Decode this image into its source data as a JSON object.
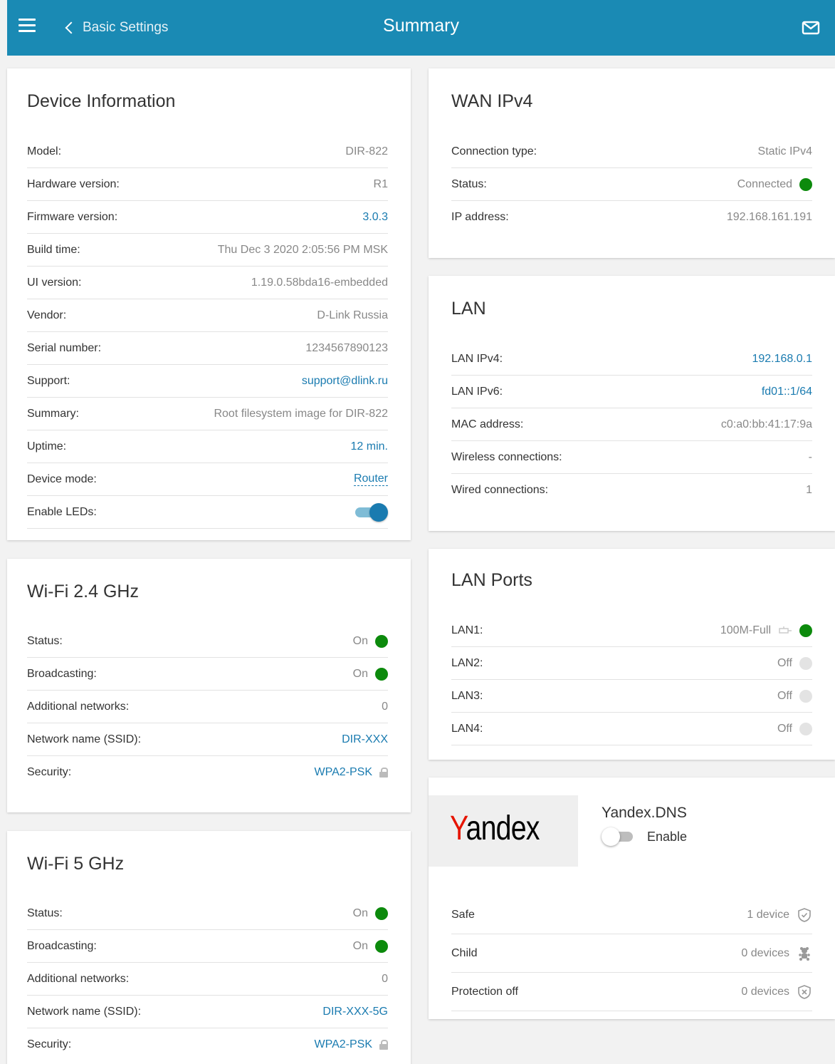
{
  "header": {
    "back_label": "Basic Settings",
    "title": "Summary",
    "menu_icon": "hamburger-menu-icon",
    "back_icon": "chevron-left-icon",
    "mail_icon": "envelope-icon",
    "color": "#1a8ab4"
  },
  "device_info": {
    "title": "Device Information",
    "rows": [
      {
        "label": "Model:",
        "value": "DIR-822"
      },
      {
        "label": "Hardware version:",
        "value": "R1"
      },
      {
        "label": "Firmware version:",
        "value": "3.0.3"
      },
      {
        "label": "Build time:",
        "value": "Thu Dec 3 2020 2:05:56 PM MSK"
      },
      {
        "label": "UI version:",
        "value": "1.19.0.58bda16-embedded"
      },
      {
        "label": "Vendor:",
        "value": "D-Link Russia"
      },
      {
        "label": "Serial number:",
        "value": "1234567890123"
      },
      {
        "label": "Support:",
        "value": "support@dlink.ru"
      },
      {
        "label": "Summary:",
        "value": "Root filesystem image for DIR-822"
      },
      {
        "label": "Uptime:",
        "value": "12 min."
      },
      {
        "label": "Device mode:",
        "value": "Router"
      },
      {
        "label": "Enable LEDs:",
        "value": "on"
      }
    ]
  },
  "wifi24": {
    "title": "Wi-Fi 2.4 GHz",
    "rows": [
      {
        "label": "Status:",
        "value": "On"
      },
      {
        "label": "Broadcasting:",
        "value": "On"
      },
      {
        "label": "Additional networks:",
        "value": "0"
      },
      {
        "label": "Network name (SSID):",
        "value": "DIR-XXX"
      },
      {
        "label": "Security:",
        "value": "WPA2-PSK"
      }
    ]
  },
  "wifi5": {
    "title": "Wi-Fi 5 GHz",
    "rows": [
      {
        "label": "Status:",
        "value": "On"
      },
      {
        "label": "Broadcasting:",
        "value": "On"
      },
      {
        "label": "Additional networks:",
        "value": "0"
      },
      {
        "label": "Network name (SSID):",
        "value": "DIR-XXX-5G"
      },
      {
        "label": "Security:",
        "value": "WPA2-PSK"
      }
    ]
  },
  "wan": {
    "title": "WAN IPv4",
    "rows": [
      {
        "label": "Connection type:",
        "value": "Static IPv4"
      },
      {
        "label": "Status:",
        "value": "Connected"
      },
      {
        "label": "IP address:",
        "value": "192.168.161.191"
      }
    ]
  },
  "lan": {
    "title": "LAN",
    "rows": [
      {
        "label": "LAN IPv4:",
        "value": "192.168.0.1"
      },
      {
        "label": "LAN IPv6:",
        "value": "fd01::1/64"
      },
      {
        "label": "MAC address:",
        "value": "c0:a0:bb:41:17:9a"
      },
      {
        "label": "Wireless connections:",
        "value": "-"
      },
      {
        "label": "Wired connections:",
        "value": "1"
      }
    ]
  },
  "lan_ports": {
    "title": "LAN Ports",
    "rows": [
      {
        "label": "LAN1:",
        "value": "100M-Full",
        "state": "on"
      },
      {
        "label": "LAN2:",
        "value": "Off",
        "state": "off"
      },
      {
        "label": "LAN3:",
        "value": "Off",
        "state": "off"
      },
      {
        "label": "LAN4:",
        "value": "Off",
        "state": "off"
      }
    ]
  },
  "yandex": {
    "logo_text_first": "Y",
    "logo_text_rest": "andex",
    "title": "Yandex.DNS",
    "toggle_label": "Enable",
    "toggle_state": "off",
    "rows": [
      {
        "label": "Safe",
        "value": "1 device",
        "icon": "shield-check-icon"
      },
      {
        "label": "Child",
        "value": "0 devices",
        "icon": "child-bear-icon"
      },
      {
        "label": "Protection off",
        "value": "0 devices",
        "icon": "shield-x-icon"
      }
    ]
  },
  "colors": {
    "link": "#1a7bb0",
    "status_green": "#0c8a0c",
    "status_grey": "#e3e3e3",
    "yandex_red": "#e61400"
  }
}
